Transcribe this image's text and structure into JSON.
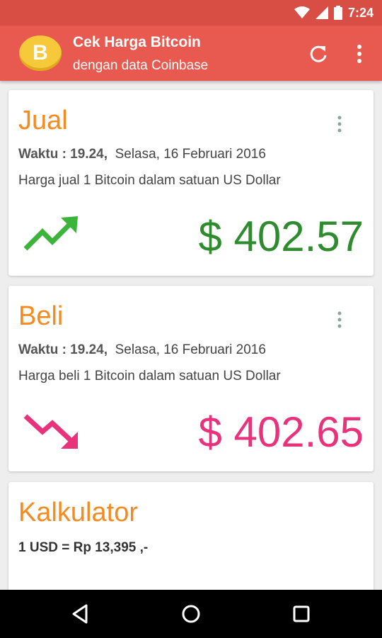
{
  "status_bar": {
    "time": "7:24"
  },
  "app_bar": {
    "logo_letter": "B",
    "title": "Cek Harga Bitcoin",
    "subtitle": "dengan data Coinbase"
  },
  "sell_card": {
    "title": "Jual",
    "time_label": "Waktu : 19.24,",
    "date": "Selasa, 16 Februari 2016",
    "description": "Harga jual 1 Bitcoin dalam satuan US Dollar",
    "price": "$ 402.57",
    "trend_icon": "trending-up-icon",
    "color": "#2e8b2e"
  },
  "buy_card": {
    "title": "Beli",
    "time_label": "Waktu : 19.24,",
    "date": "Selasa, 16 Februari 2016",
    "description": "Harga beli 1 Bitcoin dalam satuan US Dollar",
    "price": "$ 402.65",
    "trend_icon": "trending-down-icon",
    "color": "#e8327c"
  },
  "calculator_card": {
    "title": "Kalkulator",
    "rate": "1 USD = Rp 13,395 ,-"
  },
  "colors": {
    "accent": "#f58a1f",
    "app_bar": "#e85a4f",
    "status_bar": "#d84e44"
  }
}
